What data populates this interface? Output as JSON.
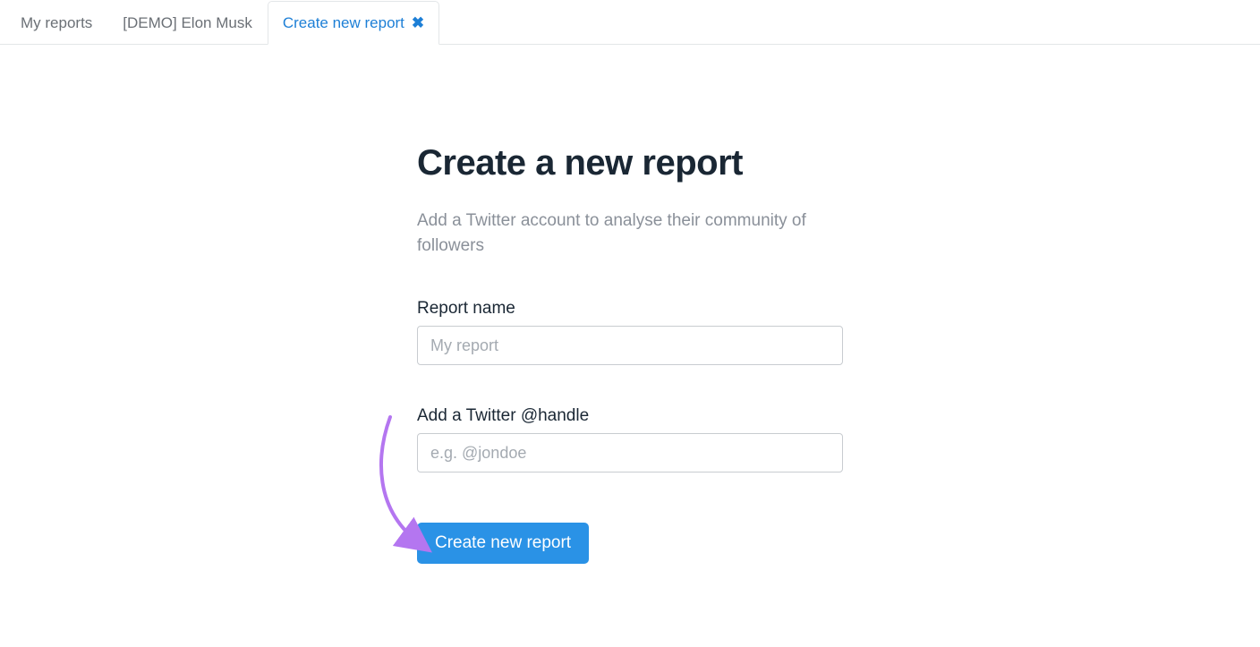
{
  "tabs": {
    "items": [
      {
        "label": "My reports",
        "closable": false,
        "active": false
      },
      {
        "label": "[DEMO] Elon Musk",
        "closable": false,
        "active": false
      },
      {
        "label": "Create new report",
        "closable": true,
        "active": true
      }
    ]
  },
  "form": {
    "heading": "Create a new report",
    "subheading": "Add a Twitter account to analyse their community of followers",
    "report_name_label": "Report name",
    "report_name_placeholder": "My report",
    "handle_label": "Add a Twitter @handle",
    "handle_placeholder": "e.g. @jondoe",
    "submit_label": "Create new report"
  },
  "annotation": {
    "arrow_color": "#b476f0"
  }
}
